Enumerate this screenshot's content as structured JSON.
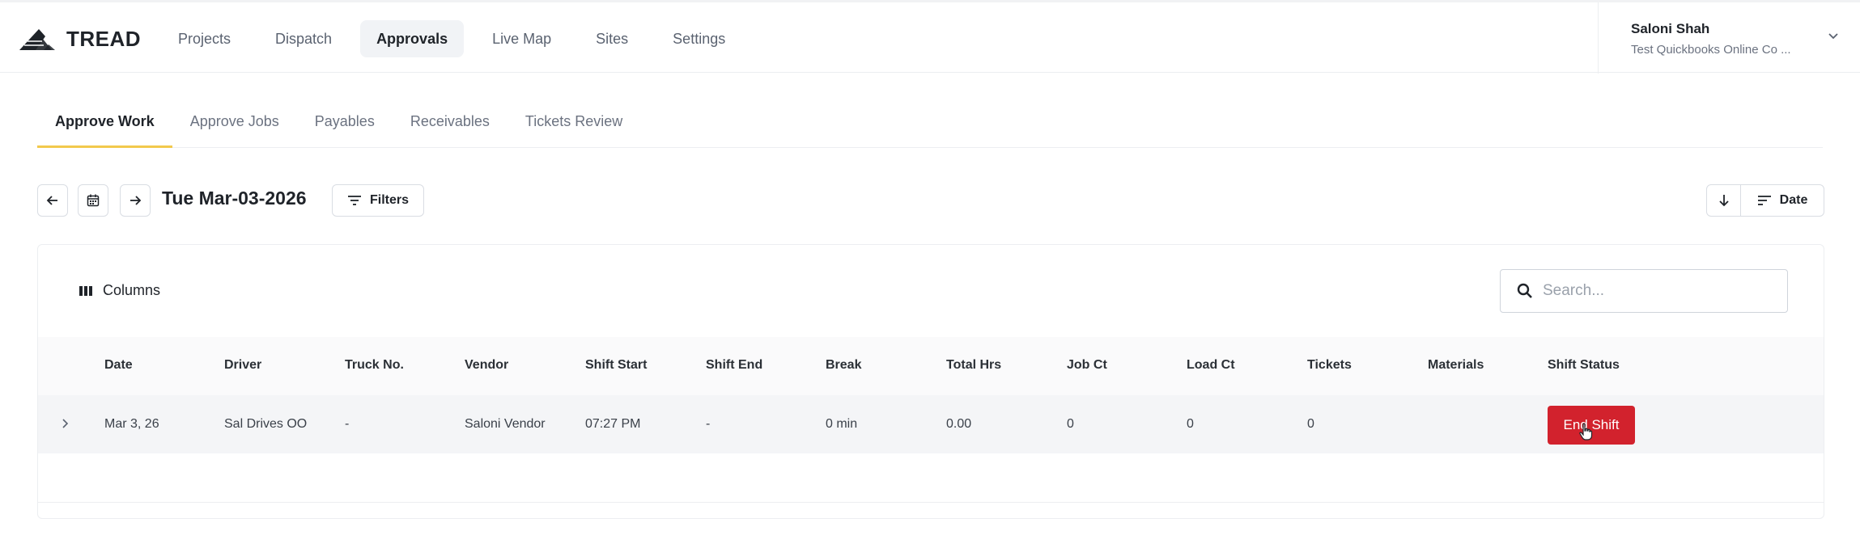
{
  "app": {
    "logo_text": "TREAD"
  },
  "nav": {
    "items": [
      {
        "label": "Projects",
        "active": false
      },
      {
        "label": "Dispatch",
        "active": false
      },
      {
        "label": "Approvals",
        "active": true
      },
      {
        "label": "Live Map",
        "active": false
      },
      {
        "label": "Sites",
        "active": false
      },
      {
        "label": "Settings",
        "active": false
      }
    ]
  },
  "user": {
    "name": "Saloni Shah",
    "org": "Test Quickbooks Online Co ..."
  },
  "tabs": [
    {
      "label": "Approve Work",
      "active": true
    },
    {
      "label": "Approve Jobs",
      "active": false
    },
    {
      "label": "Payables",
      "active": false
    },
    {
      "label": "Receivables",
      "active": false
    },
    {
      "label": "Tickets Review",
      "active": false
    }
  ],
  "toolbar": {
    "date": "Tue Mar-03-2026",
    "filters_label": "Filters",
    "sort_label": "Date"
  },
  "table": {
    "columns_label": "Columns",
    "search_placeholder": "Search...",
    "headers": [
      "Date",
      "Driver",
      "Truck No.",
      "Vendor",
      "Shift Start",
      "Shift End",
      "Break",
      "Total Hrs",
      "Job Ct",
      "Load Ct",
      "Tickets",
      "Materials",
      "Shift Status"
    ],
    "rows": [
      {
        "date": "Mar 3, 26",
        "driver": "Sal Drives OO",
        "truck_no": "-",
        "vendor": "Saloni Vendor",
        "shift_start": "07:27 PM",
        "shift_end": "-",
        "break": "0 min",
        "total_hrs": "0.00",
        "job_ct": "0",
        "load_ct": "0",
        "tickets": "0",
        "materials": "",
        "action_label": "End Shift"
      }
    ]
  },
  "colors": {
    "accent": "#f2c94c",
    "danger": "#d2222d"
  }
}
